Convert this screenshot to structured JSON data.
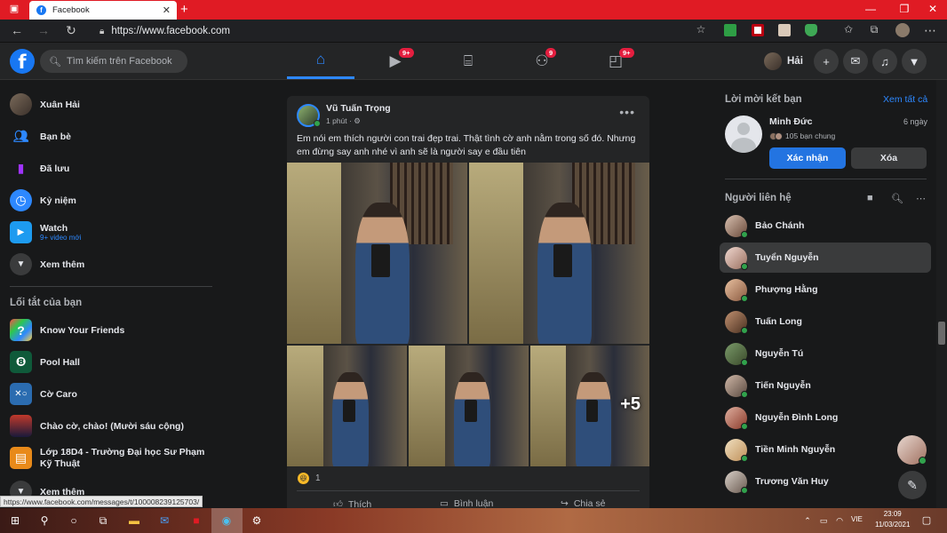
{
  "browser": {
    "tab_title": "Facebook",
    "url": "https://www.facebook.com",
    "status_url": "https://www.facebook.com/messages/t/100008239125703/"
  },
  "header": {
    "search_placeholder": "Tìm kiếm trên Facebook",
    "badges": {
      "watch": "9+",
      "groups": "9",
      "gaming": "9+"
    },
    "profile_name": "Hải"
  },
  "left": {
    "items": [
      {
        "label": "Xuân Hải",
        "icon": "avatar"
      },
      {
        "label": "Bạn bè",
        "icon": "friends-icon"
      },
      {
        "label": "Đã lưu",
        "icon": "bookmark-icon"
      },
      {
        "label": "Kỷ niệm",
        "icon": "clock-icon"
      },
      {
        "label": "Watch",
        "sub": "9+ video mới",
        "icon": "watch-icon"
      },
      {
        "label": "Xem thêm",
        "icon": "chevron-down-icon"
      }
    ],
    "shortcuts_title": "Lối tắt của bạn",
    "shortcuts": [
      {
        "label": "Know Your Friends"
      },
      {
        "label": "Pool Hall"
      },
      {
        "label": "Cờ Caro"
      },
      {
        "label": "Chào cờ, chào! (Mười sáu cộng)"
      },
      {
        "label": "Lớp 18D4 - Trường Đại học Sư Phạm Kỹ Thuật"
      },
      {
        "label": "Xem thêm"
      }
    ]
  },
  "post": {
    "author": "Vũ Tuấn Trọng",
    "time": "1 phút · ",
    "text": "Em nói em thích người con trai đẹp trai. Thật tình cờ anh nằm trong  số đó. Nhưng em đừng say anh nhé vì anh sẽ là người say e đầu tiên",
    "more_photos": "+5",
    "reaction_count": "1",
    "actions": {
      "like": "Thích",
      "comment": "Bình luận",
      "share": "Chia sẻ"
    }
  },
  "right": {
    "requests_title": "Lời mời kết bạn",
    "see_all": "Xem tất cả",
    "request": {
      "name": "Minh Đức",
      "time": "6 ngày",
      "mutual": "105 bạn chung",
      "confirm": "Xác nhận",
      "delete": "Xóa"
    },
    "contacts_title": "Người liên hệ",
    "contacts": [
      "Bảo Chánh",
      "Tuyển Nguyễn",
      "Phượng Hằng",
      "Tuấn Long",
      "Nguyễn Tú",
      "Tiến Nguyễn",
      "Nguyễn Đình Long",
      "Tiền Minh Nguyễn",
      "Trương Văn Huy"
    ]
  },
  "taskbar": {
    "lang": "VIE",
    "time": "23:09",
    "date": "11/03/2021"
  },
  "colors": {
    "accent": "#2d88ff",
    "bg": "#18191a",
    "card": "#242526",
    "browser_tab": "#e01b24"
  }
}
